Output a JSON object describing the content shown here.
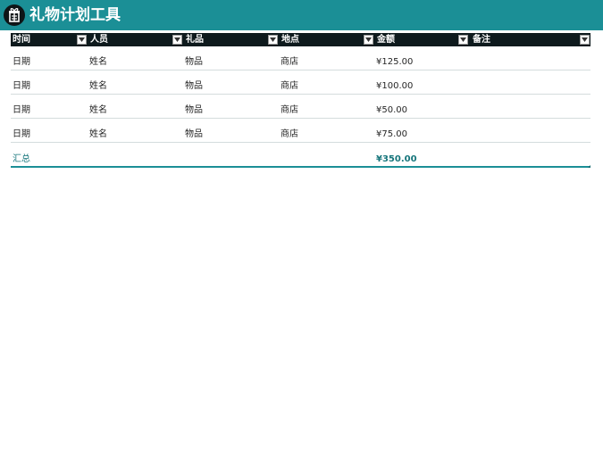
{
  "app": {
    "title": "礼物计划工具",
    "logo_icon": "gift-tag-icon",
    "brand_color": "#1b8f96",
    "header_color": "#0e1a1d"
  },
  "table": {
    "columns": [
      {
        "key": "time",
        "label": "时间"
      },
      {
        "key": "person",
        "label": "人员"
      },
      {
        "key": "gift",
        "label": "礼品"
      },
      {
        "key": "place",
        "label": "地点"
      },
      {
        "key": "amount",
        "label": "金额"
      },
      {
        "key": "notes",
        "label": "备注"
      }
    ],
    "rows": [
      {
        "time": "日期",
        "person": "姓名",
        "gift": "物品",
        "place": "商店",
        "amount": "¥125.00",
        "notes": ""
      },
      {
        "time": "日期",
        "person": "姓名",
        "gift": "物品",
        "place": "商店",
        "amount": "¥100.00",
        "notes": ""
      },
      {
        "time": "日期",
        "person": "姓名",
        "gift": "物品",
        "place": "商店",
        "amount": "¥50.00",
        "notes": ""
      },
      {
        "time": "日期",
        "person": "姓名",
        "gift": "物品",
        "place": "商店",
        "amount": "¥75.00",
        "notes": ""
      }
    ],
    "total": {
      "label": "汇总",
      "amount": "¥350.00"
    }
  }
}
